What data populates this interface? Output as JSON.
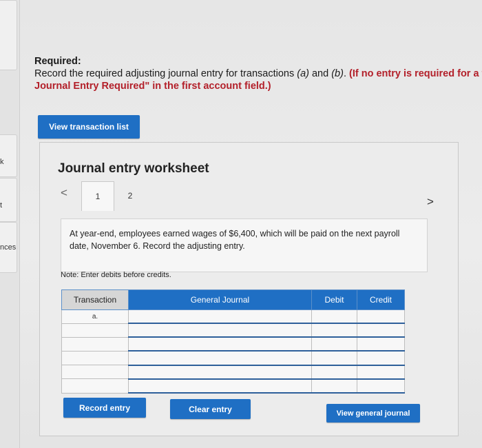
{
  "left_sidebar": {
    "fragments": [
      "k",
      "t",
      "nces"
    ]
  },
  "required": {
    "title": "Required:",
    "instruction_start": "Record the required adjusting journal entry for transactions ",
    "txn_a": "(a)",
    "and": " and ",
    "txn_b": "(b)",
    "period": ".",
    "instruction_red": " (If no entry is required for a t",
    "instruction_red_cont": "Journal Entry Required\" in the first account field.)"
  },
  "buttons": {
    "view_transaction_list": "View transaction list",
    "record_entry": "Record entry",
    "clear_entry": "Clear entry",
    "view_general_journal": "View general journal"
  },
  "worksheet": {
    "title": "Journal entry worksheet",
    "nav_prev": "<",
    "nav_next": ">",
    "tabs": [
      "1",
      "2"
    ],
    "active_tab": "1",
    "description": "At year-end, employees earned wages of $6,400, which will be paid on the next payroll date, November 6. Record the adjusting entry.",
    "note": "Note: Enter debits before credits."
  },
  "table": {
    "headers": {
      "transaction": "Transaction",
      "general_journal": "General Journal",
      "debit": "Debit",
      "credit": "Credit"
    },
    "rows": [
      {
        "transaction": "a.",
        "account": "",
        "debit": "",
        "credit": ""
      },
      {
        "transaction": "",
        "account": "",
        "debit": "",
        "credit": ""
      },
      {
        "transaction": "",
        "account": "",
        "debit": "",
        "credit": ""
      },
      {
        "transaction": "",
        "account": "",
        "debit": "",
        "credit": ""
      },
      {
        "transaction": "",
        "account": "",
        "debit": "",
        "credit": ""
      },
      {
        "transaction": "",
        "account": "",
        "debit": "",
        "credit": ""
      }
    ]
  },
  "colors": {
    "accent_blue": "#1f6fc4",
    "required_red": "#b3202a"
  }
}
